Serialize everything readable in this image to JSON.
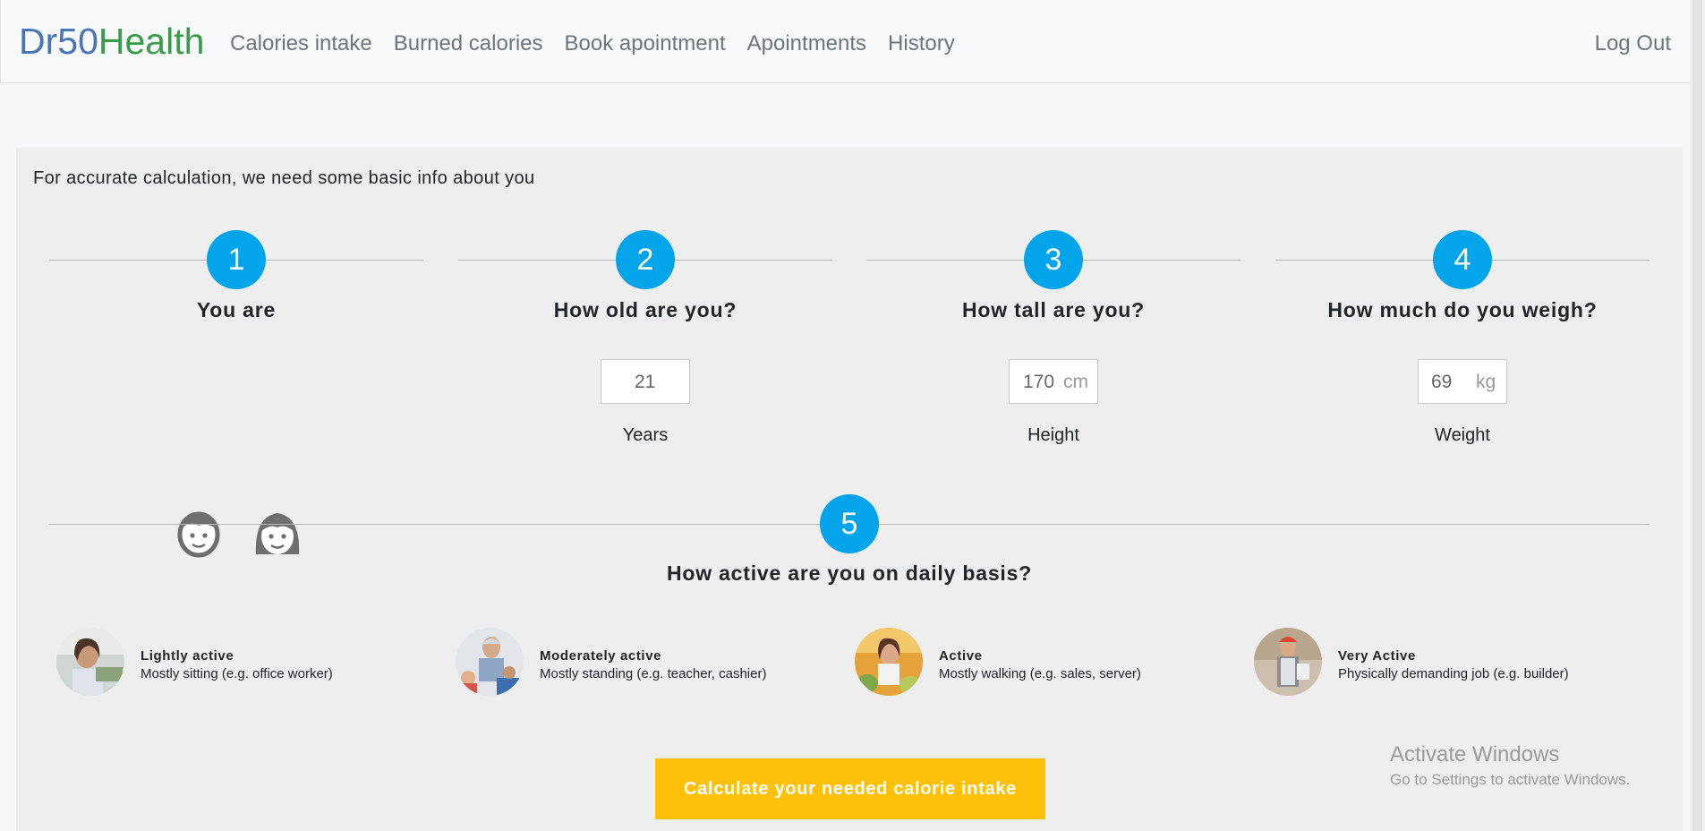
{
  "brand": {
    "part1": "Dr50",
    "part2": "Health"
  },
  "nav": {
    "items": [
      "Calories intake",
      "Burned calories",
      "Book apointment",
      "Apointments",
      "History"
    ],
    "logout": "Log Out"
  },
  "intro": "For accurate calculation, we need some basic info about you",
  "steps": [
    {
      "number": "1",
      "question": "You are"
    },
    {
      "number": "2",
      "question": "How old are you?",
      "value": "21",
      "unit": "",
      "label": "Years"
    },
    {
      "number": "3",
      "question": "How tall are you?",
      "value": "170",
      "unit": "cm",
      "label": "Height"
    },
    {
      "number": "4",
      "question": "How much do you weigh?",
      "value": "69",
      "unit": "kg",
      "label": "Weight"
    },
    {
      "number": "5",
      "question": "How active are you on daily basis?"
    }
  ],
  "activity": [
    {
      "title": "Lightly active",
      "desc": "Mostly sitting (e.g. office worker)"
    },
    {
      "title": "Moderately active",
      "desc": "Mostly standing (e.g. teacher, cashier)"
    },
    {
      "title": "Active",
      "desc": "Mostly walking (e.g. sales, server)"
    },
    {
      "title": "Very Active",
      "desc": "Physically demanding job (e.g. builder)"
    }
  ],
  "calculate_button": "Calculate your needed calorie intake",
  "watermark": {
    "line1": "Activate Windows",
    "line2": "Go to Settings to activate Windows."
  },
  "colors": {
    "step_circle": "#03a4ea",
    "button": "#ffc107",
    "brand_blue": "#4a74b8",
    "brand_green": "#3a9b4a"
  }
}
